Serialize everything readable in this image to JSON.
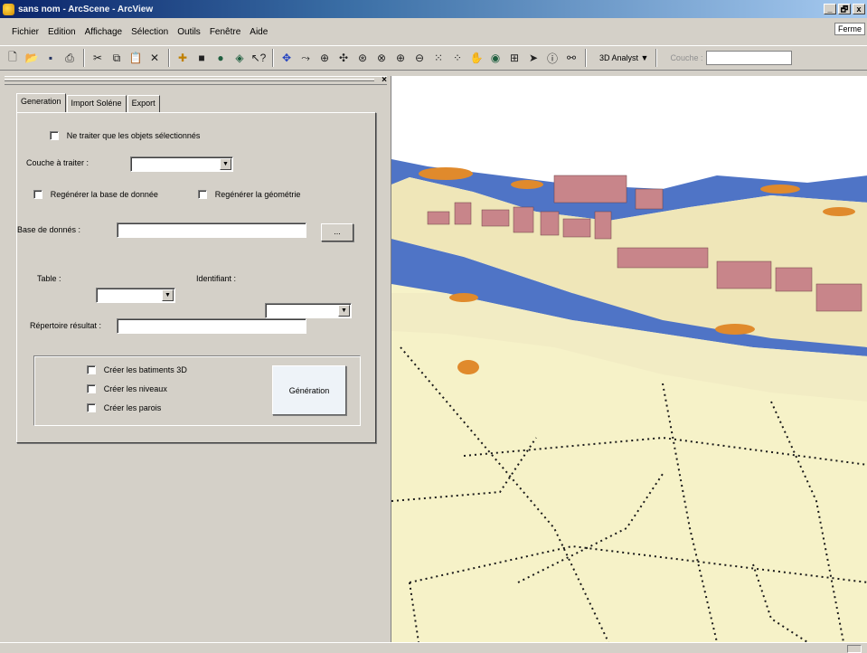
{
  "window": {
    "title": "sans nom - ArcScene - ArcView",
    "btn_min": "_",
    "btn_max": "🗗",
    "btn_close": "x",
    "fermer": "Ferme"
  },
  "menu": [
    "Fichier",
    "Edition",
    "Affichage",
    "Sélection",
    "Outils",
    "Fenêtre",
    "Aide"
  ],
  "toolbar": {
    "analyst_label": "3D Analyst ▼",
    "layer_label": "Couche :",
    "icons": [
      "new-icon",
      "open-icon",
      "save-icon",
      "print-icon",
      "cut-icon",
      "copy-icon",
      "paste-icon",
      "delete-icon",
      "add-data-icon",
      "layer-icon",
      "globe-icon",
      "scene-icon",
      "help-icon",
      "navigate-icon",
      "fly-icon",
      "zoom-target-icon",
      "pan-target-icon",
      "center-target-icon",
      "zoom-icon",
      "zoom-in-icon",
      "zoom-out-icon",
      "full-extent-icon",
      "extent-icon",
      "pan-icon",
      "globe-view-icon",
      "identify-icon",
      "select-icon",
      "info-icon",
      "find-icon"
    ]
  },
  "panel": {
    "close": "×",
    "tabs": [
      {
        "label": "Generation",
        "active": true
      },
      {
        "label": "Import Soléne",
        "active": false
      },
      {
        "label": "Export",
        "active": false
      }
    ],
    "only_selected_label": "Ne traiter que les objets sélectionnés",
    "couche_label": "Couche à traiter :",
    "couche_value": "",
    "regen_db_label": "Regénérer la base de donnée",
    "regen_geom_label": "Regénérer la géométrie",
    "db_label": "Base de donnés :",
    "db_value": "",
    "browse_label": "...",
    "table_label": "Table :",
    "table_value": "",
    "id_label": "Identifiant :",
    "id_value": "",
    "result_label": "Répertoire résultat :",
    "result_value": "",
    "options": [
      {
        "label": "Créer les batiments 3D",
        "checked": false
      },
      {
        "label": "Créer les niveaux",
        "checked": false
      },
      {
        "label": "Créer les parois",
        "checked": false
      }
    ],
    "generate_label": "Génération"
  },
  "scene": {
    "colors": {
      "water": "#4f74c6",
      "ground": "#f6f2c8",
      "buildings": "#c8858a",
      "vegetation": "#e08a2c",
      "streets": "#1a1a1a"
    }
  }
}
